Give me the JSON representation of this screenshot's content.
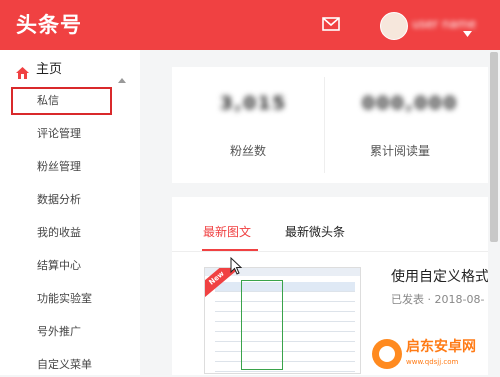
{
  "app": {
    "logo_text": "头条号"
  },
  "header": {
    "mail_icon": "mail-icon",
    "username": "user name"
  },
  "sidebar": {
    "home": {
      "label": "主页",
      "icon": "home-icon"
    },
    "items": [
      {
        "label": "私信"
      },
      {
        "label": "评论管理"
      },
      {
        "label": "粉丝管理"
      },
      {
        "label": "数据分析"
      },
      {
        "label": "我的收益"
      },
      {
        "label": "结算中心"
      },
      {
        "label": "功能实验室"
      },
      {
        "label": "号外推广"
      },
      {
        "label": "自定义菜单"
      }
    ]
  },
  "stats": [
    {
      "value": "3,015",
      "label": "粉丝数"
    },
    {
      "value": "000,000",
      "label": "累计阅读量"
    }
  ],
  "tabs": [
    {
      "label": "最新图文",
      "active": true
    },
    {
      "label": "最新微头条",
      "active": false
    }
  ],
  "article": {
    "title": "使用自定义格式",
    "status": "已发表",
    "date": "2018-08-",
    "thumbnail_badge": "New"
  },
  "watermark": {
    "name": "启东安卓网",
    "url": "www.qdsjj.com"
  },
  "colors": {
    "accent": "#f04142",
    "watermark": "#ff7b16"
  }
}
